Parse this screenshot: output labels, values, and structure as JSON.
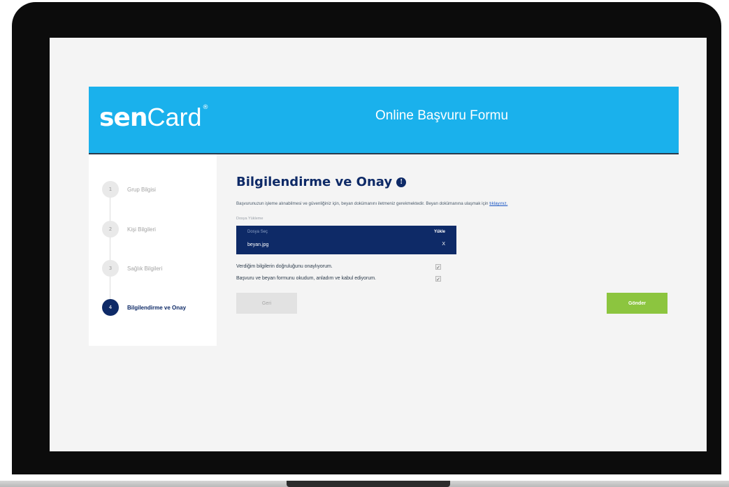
{
  "header": {
    "logo_bold": "sen",
    "logo_light": "Card",
    "logo_mark": "®",
    "title": "Online Başvuru Formu"
  },
  "steps": [
    {
      "number": "1",
      "label": "Grup Bilgisi",
      "active": false
    },
    {
      "number": "2",
      "label": "Kişi Bilgileri",
      "active": false
    },
    {
      "number": "3",
      "label": "Sağlık Bilgileri",
      "active": false
    },
    {
      "number": "4",
      "label": "Bilgilendirme ve Onay",
      "active": true
    }
  ],
  "content": {
    "title": "Bilgilendirme ve Onay",
    "info_icon": "!",
    "description": "Başvurunuzun işleme alınabilmesi ve güvenliğiniz için, beyan dokümanını iletmeniz gerekmektedir. Beyan dokümanına ulaşmak için",
    "description_link": "tıklayınız.",
    "upload": {
      "label": "Dosya Yükleme",
      "header": "Dosya Seç",
      "button": "Yükle",
      "filename": "beyan.jpg",
      "remove": "X"
    },
    "consents": [
      {
        "text": "Verdiğim bilgilerin doğruluğunu onaylıyorum.",
        "checked": true,
        "mark": "✓"
      },
      {
        "text": "Başvuru ve beyan formunu okudum, anladım ve kabul ediyorum.",
        "checked": true,
        "mark": "✓"
      }
    ],
    "buttons": {
      "back": "Geri",
      "submit": "Gönder"
    }
  },
  "colors": {
    "header_bg": "#1ab1ec",
    "navy": "#0e2a67",
    "submit_green": "#8cc53f"
  }
}
